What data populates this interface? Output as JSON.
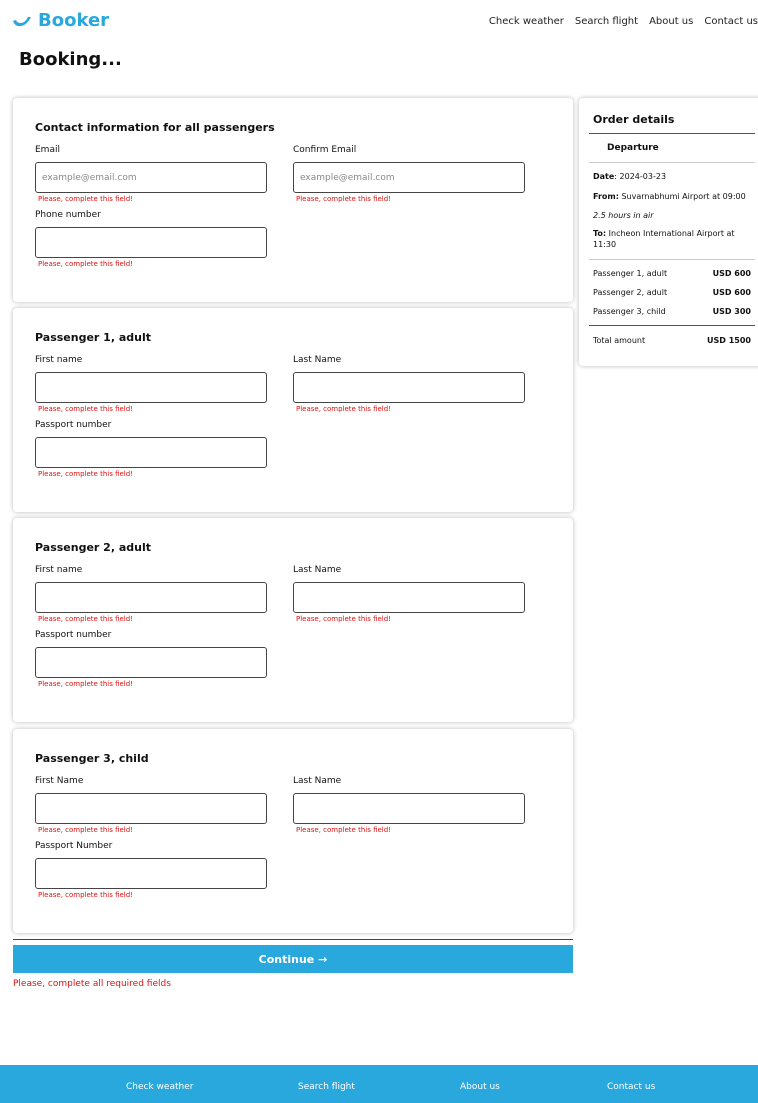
{
  "header": {
    "logo": "Booker",
    "nav": [
      "Check weather",
      "Search flight",
      "About us",
      "Contact us"
    ]
  },
  "page_title": "Booking...",
  "contact": {
    "title": "Contact information for all passengers",
    "email_label": "Email",
    "email_placeholder": "example@email.com",
    "confirm_label": "Confirm Email",
    "confirm_placeholder": "example@email.com",
    "phone_label": "Phone number",
    "error": "Please, complete this field!"
  },
  "passengers": [
    {
      "title": "Passenger 1, adult",
      "first_label": "First name",
      "last_label": "Last Name",
      "passport_label": "Passport number",
      "error": "Please, complete this field!"
    },
    {
      "title": "Passenger 2, adult",
      "first_label": "First name",
      "last_label": "Last Name",
      "passport_label": "Passport number",
      "error": "Please, complete this field!"
    },
    {
      "title": "Passenger 3, child",
      "first_label": "First Name",
      "last_label": "Last Name",
      "passport_label": "Passport Number",
      "error": "Please, complete this field!"
    }
  ],
  "continue_label": "Continue →",
  "global_error": "Please, complete all required fields",
  "order": {
    "title": "Order details",
    "departure": "Departure",
    "date_label": "Date",
    "date_value": ": 2024-03-23",
    "from_label": "From:",
    "from_value": " Suvarnabhumi Airport at 09:00",
    "duration": "2.5 hours in air",
    "to_label": "To:",
    "to_value": " Incheon International Airport at 11:30",
    "items": [
      {
        "label": "Passenger 1, adult",
        "amount": "USD 600"
      },
      {
        "label": "Passenger 2, adult",
        "amount": "USD 600"
      },
      {
        "label": "Passenger 3, child",
        "amount": "USD 300"
      }
    ],
    "total_label": "Total amount",
    "total_amount": "USD 1500"
  },
  "footer": [
    "Check weather",
    "Search flight",
    "About us",
    "Contact us"
  ],
  "colors": {
    "brand": "#29a8dd",
    "error": "#dd1111"
  }
}
